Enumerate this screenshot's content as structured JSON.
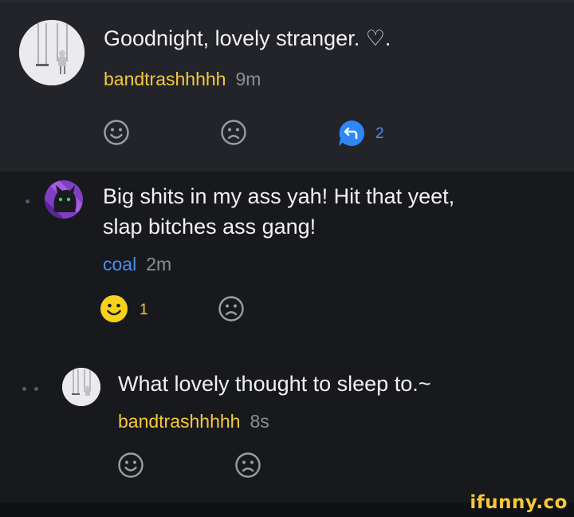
{
  "comments": [
    {
      "text": "Goodnight, lovely stranger. ♡.",
      "username": "bandtrashhhhh",
      "time": "9m",
      "reply_count": "2"
    },
    {
      "text_line1": "Big shits in my ass yah! Hit that yeet,",
      "text_line2": "slap bitches ass gang!",
      "username": "coal",
      "time": "2m",
      "smile_count": "1"
    },
    {
      "text": "What lovely thought to sleep to.~",
      "username": "bandtrashhhhh",
      "time": "8s"
    }
  ],
  "icons": {
    "smile": "smile-icon",
    "frown": "frown-icon",
    "reply": "reply-icon",
    "avatar_swing": "swing-avatar",
    "avatar_cat": "cat-avatar"
  },
  "colors": {
    "username_yellow": "#f6c93a",
    "username_blue": "#4a8df2",
    "reply_blue": "#2f86f6",
    "smile_active": "#f7d21a"
  },
  "watermark": "ifunny.co"
}
